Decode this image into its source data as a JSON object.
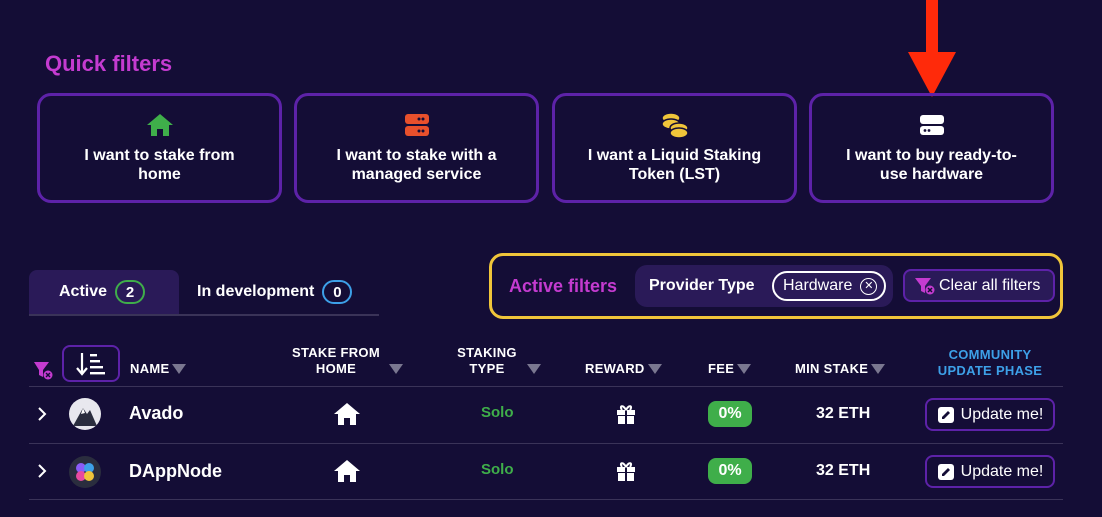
{
  "quick_filters": {
    "title": "Quick filters",
    "cards": [
      {
        "label": "I want to stake from home",
        "icon": "home-icon",
        "color": "#3fae4a"
      },
      {
        "label": "I want to stake with a managed service",
        "icon": "server-icon",
        "color": "#e8502c"
      },
      {
        "label": "I want a Liquid Staking Token (LST)",
        "icon": "coins-icon",
        "color": "#f0c53a"
      },
      {
        "label": "I want to buy ready-to-use hardware",
        "icon": "hardware-icon",
        "color": "#ffffff"
      }
    ]
  },
  "tabs": [
    {
      "label": "Active",
      "count": "2"
    },
    {
      "label": "In development",
      "count": "0"
    }
  ],
  "active_filters": {
    "label": "Active filters",
    "group_label": "Provider Type",
    "chip_label": "Hardware",
    "clear_label": "Clear all filters"
  },
  "table": {
    "headers": {
      "name": "NAME",
      "stake_from_home": "STAKE FROM HOME",
      "staking_type": "STAKING TYPE",
      "reward": "REWARD",
      "fee": "FEE",
      "min_stake": "MIN STAKE",
      "community_update": "COMMUNITY UPDATE PHASE"
    },
    "rows": [
      {
        "name": "Avado",
        "staking_type": "Solo",
        "fee": "0%",
        "min_stake": "32 ETH",
        "update_label": "Update me!"
      },
      {
        "name": "DAppNode",
        "staking_type": "Solo",
        "fee": "0%",
        "min_stake": "32 ETH",
        "update_label": "Update me!"
      }
    ]
  },
  "colors": {
    "background": "#140d36",
    "accent_purple": "#c43bd0",
    "border_purple": "#5d22a8",
    "highlight_yellow": "#f0c53a",
    "success_green": "#3fae4a",
    "info_blue": "#3da0e8",
    "arrow_red": "#ff2a0a"
  }
}
